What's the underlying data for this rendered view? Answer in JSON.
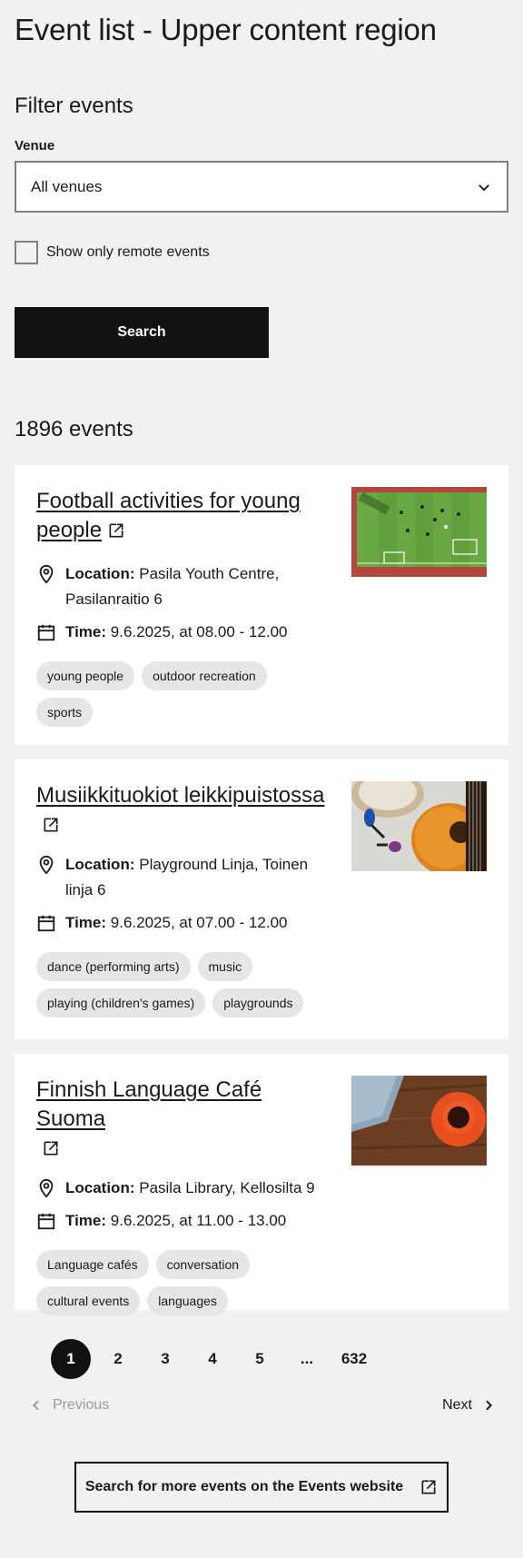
{
  "region_title": "Event list - Upper content region",
  "filter": {
    "title": "Filter events",
    "venue_label": "Venue",
    "venue_value": "All venues",
    "remote_label": "Show only remote events",
    "remote_checked": false,
    "search_label": "Search"
  },
  "event_count": "1896 events",
  "events": [
    {
      "title": "Football activities for young people",
      "location_key": "Location:",
      "location": "Pasila Youth Centre, Pasilanraitio 6",
      "time_key": "Time:",
      "time": "9.6.2025, at 08.00 - 12.00",
      "tags": [
        "young people",
        "outdoor recreation",
        "sports"
      ]
    },
    {
      "title": "Musiikkituokiot leikkipuistossa",
      "location_key": "Location:",
      "location": "Playground Linja, Toinen linja 6",
      "time_key": "Time:",
      "time": "9.6.2025, at 07.00 - 12.00",
      "tags": [
        "dance (performing arts)",
        "music",
        "playing (children's games)",
        "playgrounds"
      ]
    },
    {
      "title": "Finnish Language Café Suoma",
      "location_key": "Location:",
      "location": "Pasila Library, Kellosilta 9",
      "time_key": "Time:",
      "time": "9.6.2025, at 11.00 - 13.00",
      "tags": [
        "Language cafés",
        "conversation",
        "cultural events",
        "languages"
      ]
    }
  ],
  "pagination": {
    "pages": [
      "1",
      "2",
      "3",
      "4",
      "5"
    ],
    "ellipsis": "...",
    "last": "632",
    "current": "1",
    "prev_label": "Previous",
    "next_label": "Next"
  },
  "more_events_label": "Search for more events on the Events website",
  "colors": {
    "background": "#f1f1f1",
    "card": "#ffffff",
    "primary_button": "#111111",
    "tag": "#e6e6e6",
    "disabled_text": "#9a9a9a"
  },
  "icons": [
    "chevron-down-icon",
    "location-pin-icon",
    "calendar-icon",
    "external-link-icon",
    "chevron-left-icon",
    "chevron-right-icon"
  ]
}
